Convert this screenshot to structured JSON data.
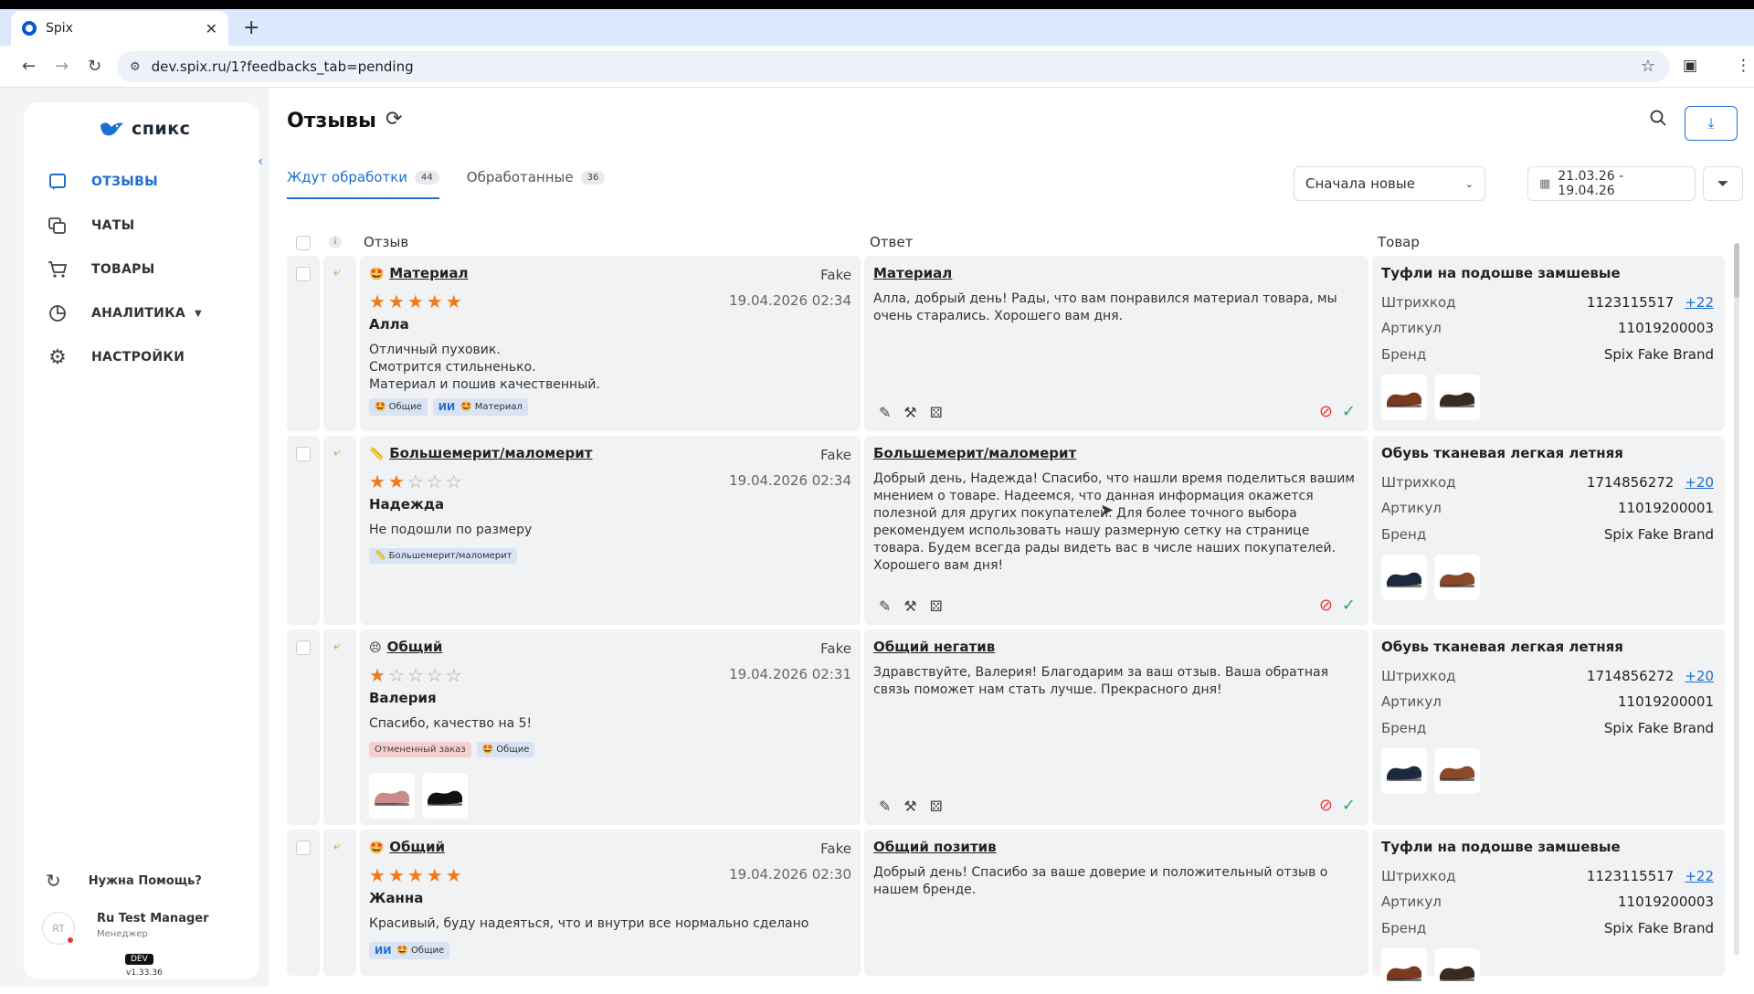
{
  "browser": {
    "tab_title": "Spix",
    "url": "dev.spix.ru/1?feedbacks_tab=pending"
  },
  "sidebar": {
    "logo_text": "спикс",
    "items": [
      {
        "label": "ОТЗЫВЫ",
        "icon": "message-square-icon",
        "active": true
      },
      {
        "label": "ЧАТЫ",
        "icon": "chat-copy-icon",
        "active": false
      },
      {
        "label": "ТОВАРЫ",
        "icon": "cart-icon",
        "active": false
      },
      {
        "label": "АНАЛИТИКА",
        "icon": "pie-chart-icon",
        "active": false
      },
      {
        "label": "НАСТРОЙКИ",
        "icon": "gear-icon",
        "active": false
      }
    ],
    "help_label": "Нужна Помощь?",
    "user": {
      "initials": "RT",
      "name": "Ru Test Manager",
      "role": "Менеджер"
    },
    "env_badge": "DEV",
    "version": "v1.33.36"
  },
  "header": {
    "title": "Отзывы",
    "tabs": [
      {
        "label": "Ждут обработки",
        "count": "44",
        "active": true
      },
      {
        "label": "Обработанные",
        "count": "36",
        "active": false
      }
    ],
    "sort_label": "Сначала новые",
    "date_range": "21.03.26 - 19.04.26"
  },
  "table": {
    "columns": {
      "review": "Отзыв",
      "answer": "Ответ",
      "product": "Товар"
    },
    "product_labels": {
      "barcode": "Штрихкод",
      "article": "Артикул",
      "brand": "Бренд"
    },
    "rows": [
      {
        "review_title": "Материал",
        "emoji": "🤩",
        "source": "Fake",
        "rating": 5,
        "date": "19.04.2026 02:34",
        "author": "Алла",
        "text": [
          "Отличный пуховик.",
          "Смотрится стильненько.",
          "Материал и пошив качественный."
        ],
        "tags": [
          {
            "label": "🤩 Общие",
            "ai": false
          },
          {
            "label": "🤩 Материал",
            "ai": true
          }
        ],
        "answer_title": "Материал",
        "answer_text": "Алла, добрый день! Рады, что вам понравился материал товара, мы очень старались. Хорошего вам дня.",
        "product_name": "Туфли на подошве замшевые",
        "barcode": "1123115517",
        "barcode_more": "+22",
        "article": "11019200003",
        "brand": "Spix Fake Brand"
      },
      {
        "review_title": "Большемерит/маломерит",
        "emoji": "📏",
        "source": "Fake",
        "rating": 2,
        "date": "19.04.2026 02:34",
        "author": "Надежда",
        "text": [
          "Не подошли по размеру"
        ],
        "tags": [
          {
            "label": "📏 Большемерит/маломерит",
            "ai": false
          }
        ],
        "answer_title": "Большемерит/маломерит",
        "answer_text": "Добрый день, Надежда! Спасибо, что нашли время поделиться вашим мнением о товаре. Надеемся, что данная информация окажется полезной для других покупателей. Для более точного выбора рекомендуем использовать нашу размерную сетку на странице товара. Будем всегда рады видеть вас в числе наших покупателей. Хорошего вам дня!",
        "product_name": "Обувь тканевая легкая летняя",
        "barcode": "1714856272",
        "barcode_more": "+20",
        "article": "11019200001",
        "brand": "Spix Fake Brand"
      },
      {
        "review_title": "Общий",
        "emoji": "😣",
        "source": "Fake",
        "rating": 1,
        "date": "19.04.2026 02:31",
        "author": "Валерия",
        "text": [
          "Спасибо, качество на 5!"
        ],
        "tags": [
          {
            "label": "Отмененный заказ",
            "ai": false,
            "red": true
          },
          {
            "label": "🤩 Общие",
            "ai": false
          }
        ],
        "answer_title": "Общий негатив",
        "answer_text": "Здравствуйте, Валерия! Благодарим за ваш отзыв. Ваша обратная связь поможет нам стать лучше. Прекрасного дня!",
        "product_name": "Обувь тканевая легкая летняя",
        "barcode": "1714856272",
        "barcode_more": "+20",
        "article": "11019200001",
        "brand": "Spix Fake Brand"
      },
      {
        "review_title": "Общий",
        "emoji": "🤩",
        "source": "Fake",
        "rating": 5,
        "date": "19.04.2026 02:30",
        "author": "Жанна",
        "text": [
          "Красивый, буду надеяться, что и внутри все нормально сделано"
        ],
        "tags": [
          {
            "label": "🤩 Общие",
            "ai": true
          }
        ],
        "answer_title": "Общий позитив",
        "answer_text": "Добрый день! Спасибо за ваше доверие и положительный отзыв о нашем бренде.",
        "product_name": "Туфли на подошве замшевые",
        "barcode": "1123115517",
        "barcode_more": "+22",
        "article": "11019200003",
        "brand": "Spix Fake Brand"
      }
    ]
  }
}
